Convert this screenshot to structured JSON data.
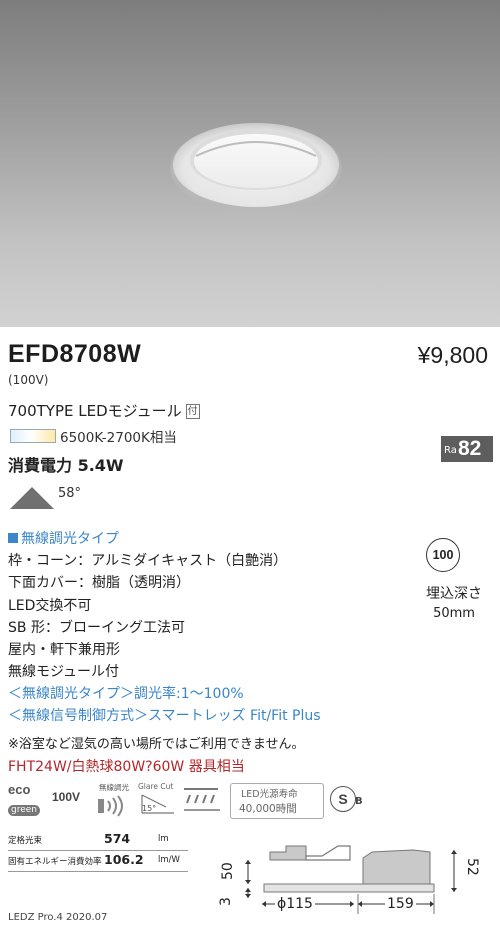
{
  "product": {
    "model": "EFD8708W",
    "price": "¥9,800",
    "voltage": "(100V)",
    "type_line": "700TYPE LEDモジュール",
    "type_badge": "付",
    "color_temp": "6500K-2700K相当",
    "power": "消費電力 5.4W",
    "ra_label": "Ra",
    "ra_value": "82",
    "beam_angle": "58°"
  },
  "specs": {
    "wireless_label": "無線調光タイプ",
    "lines": [
      "枠・コーン：アルミダイキャスト（白艶消）",
      "下面カバー：樹脂（透明消）",
      "LED交換不可",
      "SB 形：ブローイング工法可",
      "屋内・軒下兼用形",
      "無線モジュール付"
    ],
    "blue_lines": [
      "＜無線調光タイプ＞調光率:1～100%",
      "＜無線信号制御方式＞スマートレッズ Fit/Fit Plus"
    ],
    "note": "※浴室など湿気の高い場所ではご利用できません。",
    "lamp_equiv": "FHT24W/白熱球80W?60W 器具相当"
  },
  "install": {
    "circle_value": "100",
    "embed_label": "埋込深さ",
    "embed_depth": "50mm"
  },
  "icons": {
    "eco_top": "eco",
    "eco_bottom": "green",
    "voltage_icon": "100V",
    "wireless_icon": "無線調光",
    "glare_cut": "Glare Cut",
    "glare_angle": "15°",
    "life_top": "LED光源寿命",
    "life_bottom": "40,000時間",
    "sb_mark": "S",
    "sb_sub": "B"
  },
  "table": {
    "rows": [
      {
        "label": "定格光束",
        "value": "574",
        "unit": "lm"
      },
      {
        "label": "固有エネルギー消費効率",
        "value": "106.2",
        "unit": "lm/W"
      }
    ]
  },
  "dimensions": {
    "height_left": "50",
    "small_left": "3",
    "cutout": "ϕ115",
    "width": "159",
    "height_right": "52"
  },
  "footer": "LEDZ Pro.4 2020.07"
}
